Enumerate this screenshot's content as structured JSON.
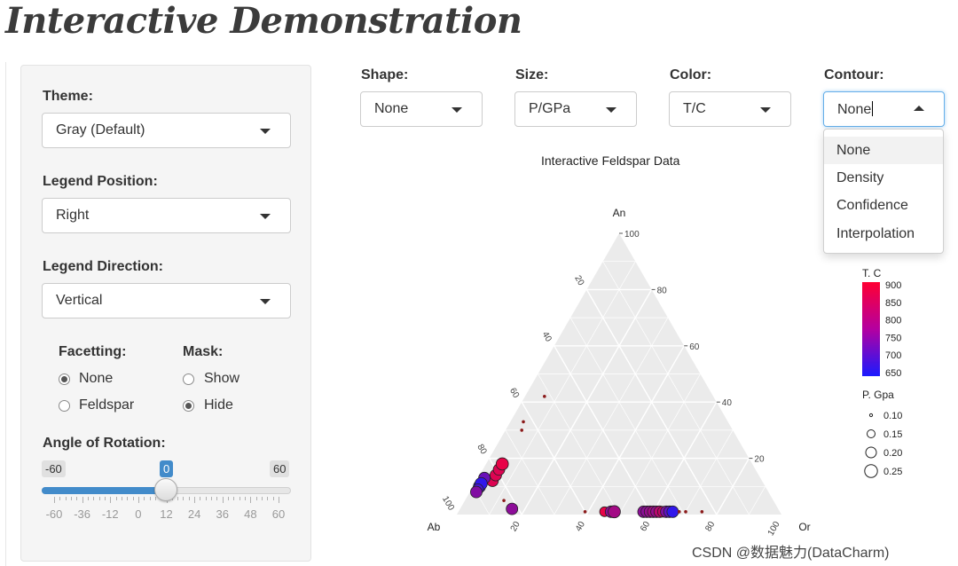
{
  "app": {
    "title": "Interactive Demonstration"
  },
  "sidebar": {
    "theme": {
      "label": "Theme:",
      "value": "Gray (Default)"
    },
    "legend_position": {
      "label": "Legend Position:",
      "value": "Right"
    },
    "legend_direction": {
      "label": "Legend Direction:",
      "value": "Vertical"
    },
    "facetting": {
      "label": "Facetting:",
      "options": [
        "None",
        "Feldspar"
      ],
      "selected": "None"
    },
    "mask": {
      "label": "Mask:",
      "options": [
        "Show",
        "Hide"
      ],
      "selected": "Hide"
    },
    "rotation": {
      "label": "Angle of Rotation:",
      "min": "-60",
      "max": "60",
      "value": "0",
      "tick_labels": [
        "-60",
        "-36",
        "-12",
        "0",
        "12",
        "24",
        "36",
        "48",
        "60"
      ]
    }
  },
  "controls": {
    "shape": {
      "label": "Shape:",
      "value": "None"
    },
    "size": {
      "label": "Size:",
      "value": "P/GPa"
    },
    "color": {
      "label": "Color:",
      "value": "T/C"
    },
    "contour": {
      "label": "Contour:",
      "value": "None",
      "options": [
        "None",
        "Density",
        "Confidence",
        "Interpolation"
      ]
    }
  },
  "plot": {
    "title": "Interactive Feldspar Data",
    "vertices": {
      "top": "An",
      "left": "Ab",
      "right": "Or"
    },
    "right_ticks": [
      "100",
      "80",
      "60",
      "40",
      "20"
    ],
    "left_ticks": [
      "20",
      "40",
      "60",
      "80",
      "100"
    ],
    "bottom_ticks": [
      "20",
      "40",
      "60",
      "80",
      "100"
    ],
    "legend_color": {
      "title": "T. C",
      "labels": [
        "900",
        "850",
        "800",
        "750",
        "700",
        "650"
      ],
      "low_color": "#1a1aff",
      "high_color": "#ff0033"
    },
    "legend_size": {
      "title": "P. Gpa",
      "labels": [
        "0.10",
        "0.15",
        "0.20",
        "0.25"
      ]
    },
    "panel_color": "#ebebeb"
  },
  "watermark": "CSDN @数据魅力(DataCharm)",
  "points": [
    {
      "An": 12,
      "Ab": 83,
      "Or": 5,
      "t": 0.85,
      "p": 0.2
    },
    {
      "An": 14,
      "Ab": 81,
      "Or": 5,
      "t": 0.85,
      "p": 0.2
    },
    {
      "An": 16,
      "Ab": 79,
      "Or": 5,
      "t": 0.85,
      "p": 0.2
    },
    {
      "An": 18,
      "Ab": 77,
      "Or": 5,
      "t": 0.9,
      "p": 0.22
    },
    {
      "An": 13,
      "Ab": 85,
      "Or": 2,
      "t": 0.35,
      "p": 0.2
    },
    {
      "An": 10,
      "Ab": 88,
      "Or": 2,
      "t": 0.1,
      "p": 0.22
    },
    {
      "An": 11,
      "Ab": 87,
      "Or": 2,
      "t": 0.1,
      "p": 0.22
    },
    {
      "An": 9,
      "Ab": 89,
      "Or": 2,
      "t": 0.2,
      "p": 0.18
    },
    {
      "An": 8,
      "Ab": 90,
      "Or": 2,
      "t": 0.45,
      "p": 0.2
    },
    {
      "An": 2,
      "Ab": 82,
      "Or": 16,
      "t": 0.5,
      "p": 0.2
    },
    {
      "An": 5,
      "Ab": 83,
      "Or": 12,
      "t": 1.0,
      "p": 0.02
    },
    {
      "An": 30,
      "Ab": 65,
      "Or": 5,
      "t": 1.0,
      "p": 0.02
    },
    {
      "An": 33,
      "Ab": 63,
      "Or": 4,
      "t": 1.0,
      "p": 0.02
    },
    {
      "An": 42,
      "Ab": 52,
      "Or": 6,
      "t": 1.0,
      "p": 0.02
    },
    {
      "An": 1,
      "Ab": 60,
      "Or": 39,
      "t": 1.0,
      "p": 0.02
    },
    {
      "An": 1,
      "Ab": 54,
      "Or": 45,
      "t": 0.9,
      "p": 0.15
    },
    {
      "An": 1,
      "Ab": 52,
      "Or": 47,
      "t": 0.5,
      "p": 0.2
    },
    {
      "An": 1,
      "Ab": 51,
      "Or": 48,
      "t": 0.6,
      "p": 0.22
    },
    {
      "An": 1,
      "Ab": 42,
      "Or": 57,
      "t": 0.5,
      "p": 0.2
    },
    {
      "An": 1,
      "Ab": 41,
      "Or": 58,
      "t": 0.5,
      "p": 0.2
    },
    {
      "An": 1,
      "Ab": 40,
      "Or": 59,
      "t": 0.55,
      "p": 0.2
    },
    {
      "An": 1,
      "Ab": 39,
      "Or": 60,
      "t": 0.6,
      "p": 0.2
    },
    {
      "An": 1,
      "Ab": 38,
      "Or": 61,
      "t": 0.55,
      "p": 0.2
    },
    {
      "An": 1,
      "Ab": 37,
      "Or": 62,
      "t": 0.7,
      "p": 0.2
    },
    {
      "An": 1,
      "Ab": 36,
      "Or": 63,
      "t": 0.75,
      "p": 0.18
    },
    {
      "An": 1,
      "Ab": 35,
      "Or": 64,
      "t": 0.45,
      "p": 0.2
    },
    {
      "An": 1,
      "Ab": 34,
      "Or": 65,
      "t": 0.3,
      "p": 0.2
    },
    {
      "An": 1,
      "Ab": 33,
      "Or": 66,
      "t": 0.1,
      "p": 0.2
    },
    {
      "An": 1,
      "Ab": 31,
      "Or": 68,
      "t": 1.0,
      "p": 0.02
    },
    {
      "An": 1,
      "Ab": 29,
      "Or": 70,
      "t": 1.0,
      "p": 0.02
    },
    {
      "An": 1,
      "Ab": 24,
      "Or": 75,
      "t": 1.0,
      "p": 0.02
    }
  ]
}
